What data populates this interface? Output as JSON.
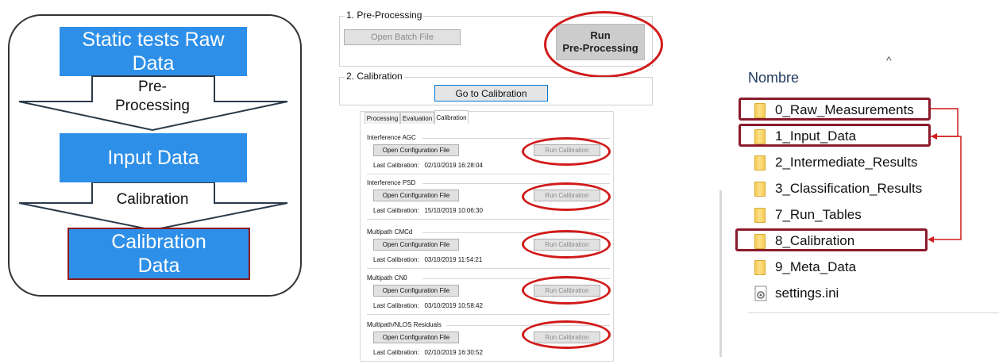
{
  "flow": {
    "raw_data_line1": "Static tests Raw",
    "raw_data_line2": "Data",
    "preprocessing_line1": "Pre-",
    "preprocessing_line2": "Processing",
    "input_data": "Input Data",
    "calibration_arrow": "Calibration",
    "calibration_data_line1": "Calibration",
    "calibration_data_line2": "Data",
    "box_color": "#2e8fe8",
    "highlight_color": "#8b1a1a"
  },
  "software": {
    "preprocessing_group": "1. Pre-Processing",
    "open_batch_file": "Open Batch File",
    "run_preprocessing_line1": "Run",
    "run_preprocessing_line2": "Pre-Processing",
    "calibration_group": "2. Calibration",
    "go_to_calibration": "Go to Calibration",
    "tabs": [
      "Processing",
      "Evaluation",
      "Calibration"
    ],
    "active_tab": "Calibration",
    "sections": [
      {
        "title": "Interference AGC",
        "open_label": "Open Configuration File",
        "run_label": "Run Calibration",
        "last_label": "Last Calibration:",
        "last_value": "02/10/2019 16:28:04"
      },
      {
        "title": "Interference PSD",
        "open_label": "Open Configuration File",
        "run_label": "Run Calibration",
        "last_label": "Last Calibration:",
        "last_value": "15/10/2019 10:06:30"
      },
      {
        "title": "Multipath CMCd",
        "open_label": "Open Configuration File",
        "run_label": "Run Calibration",
        "last_label": "Last Calibration:",
        "last_value": "03/10/2019 11:54:21"
      },
      {
        "title": "Multipath CN0",
        "open_label": "Open Configuration File",
        "run_label": "Run Calibration",
        "last_label": "Last Calibration:",
        "last_value": "03/10/2019 10:58:42"
      },
      {
        "title": "Multipath/NLOS Residuals",
        "open_label": "Open Configuration File",
        "run_label": "Run Calibration",
        "last_label": "Last Calibration:",
        "last_value": "02/10/2019 16:30:52"
      }
    ],
    "ellipse_color": "#d11a1a"
  },
  "explorer": {
    "column_header": "Nombre",
    "sort_indicator": "^",
    "items": [
      {
        "name": "0_Raw_Measurements",
        "icon": "folder-icon"
      },
      {
        "name": "1_Input_Data",
        "icon": "folder-icon"
      },
      {
        "name": "2_Intermediate_Results",
        "icon": "folder-icon"
      },
      {
        "name": "3_Classification_Results",
        "icon": "folder-icon"
      },
      {
        "name": "7_Run_Tables",
        "icon": "folder-icon"
      },
      {
        "name": "8_Calibration",
        "icon": "folder-icon"
      },
      {
        "name": "9_Meta_Data",
        "icon": "folder-icon"
      },
      {
        "name": "settings.ini",
        "icon": "settings-file-icon"
      }
    ],
    "highlight_color": "#8b1a2c",
    "arrow_color": "#d11a1a"
  }
}
